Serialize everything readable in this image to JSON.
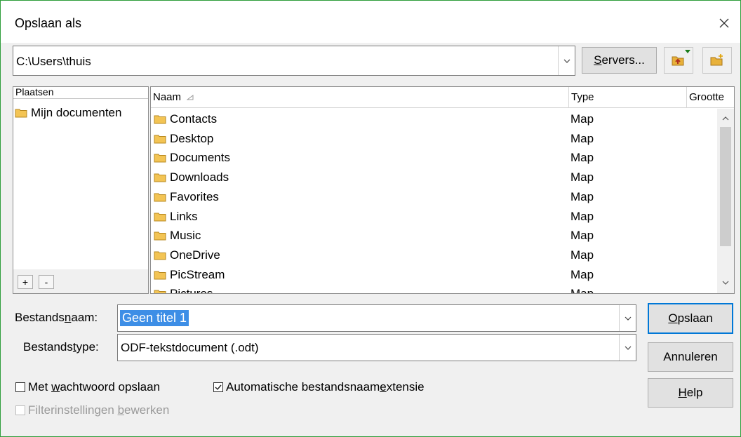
{
  "window": {
    "title": "Opslaan als"
  },
  "toolbar": {
    "path": "C:\\Users\\thuis",
    "servers_prefix": "",
    "servers_mnemonic": "S",
    "servers_rest": "ervers..."
  },
  "places": {
    "header": "Plaatsen",
    "items": [
      {
        "label": "Mijn documenten"
      }
    ],
    "add_label": "+",
    "remove_label": "-"
  },
  "files": {
    "columns": [
      {
        "label": "Naam",
        "sort": "ascending"
      },
      {
        "label": "Type"
      },
      {
        "label": "Grootte"
      }
    ],
    "rows": [
      {
        "name": "Contacts",
        "type": "Map"
      },
      {
        "name": "Desktop",
        "type": "Map"
      },
      {
        "name": "Documents",
        "type": "Map"
      },
      {
        "name": "Downloads",
        "type": "Map"
      },
      {
        "name": "Favorites",
        "type": "Map"
      },
      {
        "name": "Links",
        "type": "Map"
      },
      {
        "name": "Music",
        "type": "Map"
      },
      {
        "name": "OneDrive",
        "type": "Map"
      },
      {
        "name": "PicStream",
        "type": "Map"
      },
      {
        "name": "Pictures",
        "type": "Map"
      }
    ]
  },
  "form": {
    "filename_label_a": "Bestands",
    "filename_label_m": "n",
    "filename_label_b": "aam:",
    "filename_value": "Geen titel 1",
    "filetype_label_a": "Bestands",
    "filetype_label_m": "t",
    "filetype_label_b": "ype:",
    "filetype_value": "ODF-tekstdocument (.odt)"
  },
  "buttons": {
    "save_m": "O",
    "save_rest": "pslaan",
    "cancel": "Annuleren",
    "help_m": "H",
    "help_rest": "elp"
  },
  "options": {
    "password_a": "Met ",
    "password_m": "w",
    "password_b": "achtwoord opslaan",
    "password_checked": false,
    "autoext_a": "Automatische bestandsnaam",
    "autoext_m": "e",
    "autoext_b": "xtensie",
    "autoext_checked": true,
    "filter_a": "Filterinstellingen ",
    "filter_m": "b",
    "filter_b": "ewerken",
    "filter_checked": false,
    "filter_disabled": true
  },
  "colors": {
    "accent": "#0078d7",
    "selection": "#3d8ee6",
    "folder": "#e8b13a",
    "window_border": "#2e9d3a"
  }
}
